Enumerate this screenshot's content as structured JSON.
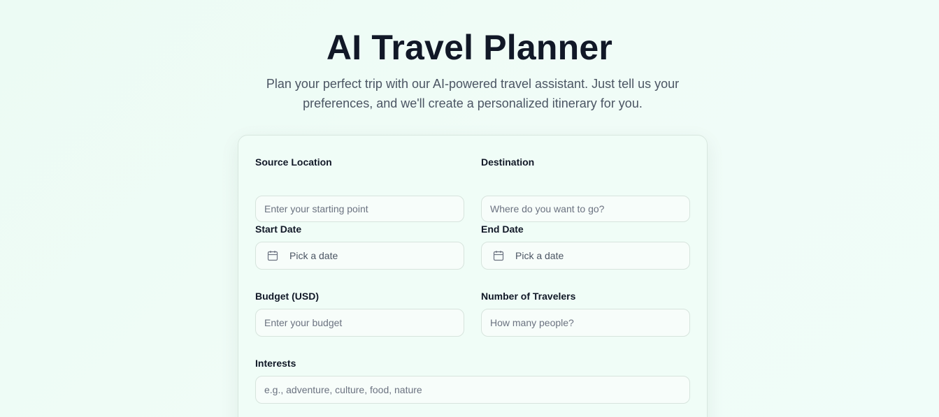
{
  "header": {
    "title": "AI Travel Planner",
    "subtitle": "Plan your perfect trip with our AI-powered travel assistant. Just tell us your preferences, and we'll create a personalized itinerary for you."
  },
  "form": {
    "source": {
      "label": "Source Location",
      "placeholder": "Enter your starting point"
    },
    "destination": {
      "label": "Destination",
      "placeholder": "Where do you want to go?"
    },
    "start_date": {
      "label": "Start Date",
      "placeholder": "Pick a date",
      "icon": "calendar-icon"
    },
    "end_date": {
      "label": "End Date",
      "placeholder": "Pick a date",
      "icon": "calendar-icon"
    },
    "budget": {
      "label": "Budget (USD)",
      "placeholder": "Enter your budget"
    },
    "travelers": {
      "label": "Number of Travelers",
      "placeholder": "How many people?"
    },
    "interests": {
      "label": "Interests",
      "placeholder": "e.g., adventure, culture, food, nature"
    }
  },
  "colors": {
    "background": "#ecfbf4",
    "title": "#111827",
    "subtitle": "#4b5563",
    "input_border": "#d7e4dd",
    "input_bg": "#f7fdfa"
  }
}
